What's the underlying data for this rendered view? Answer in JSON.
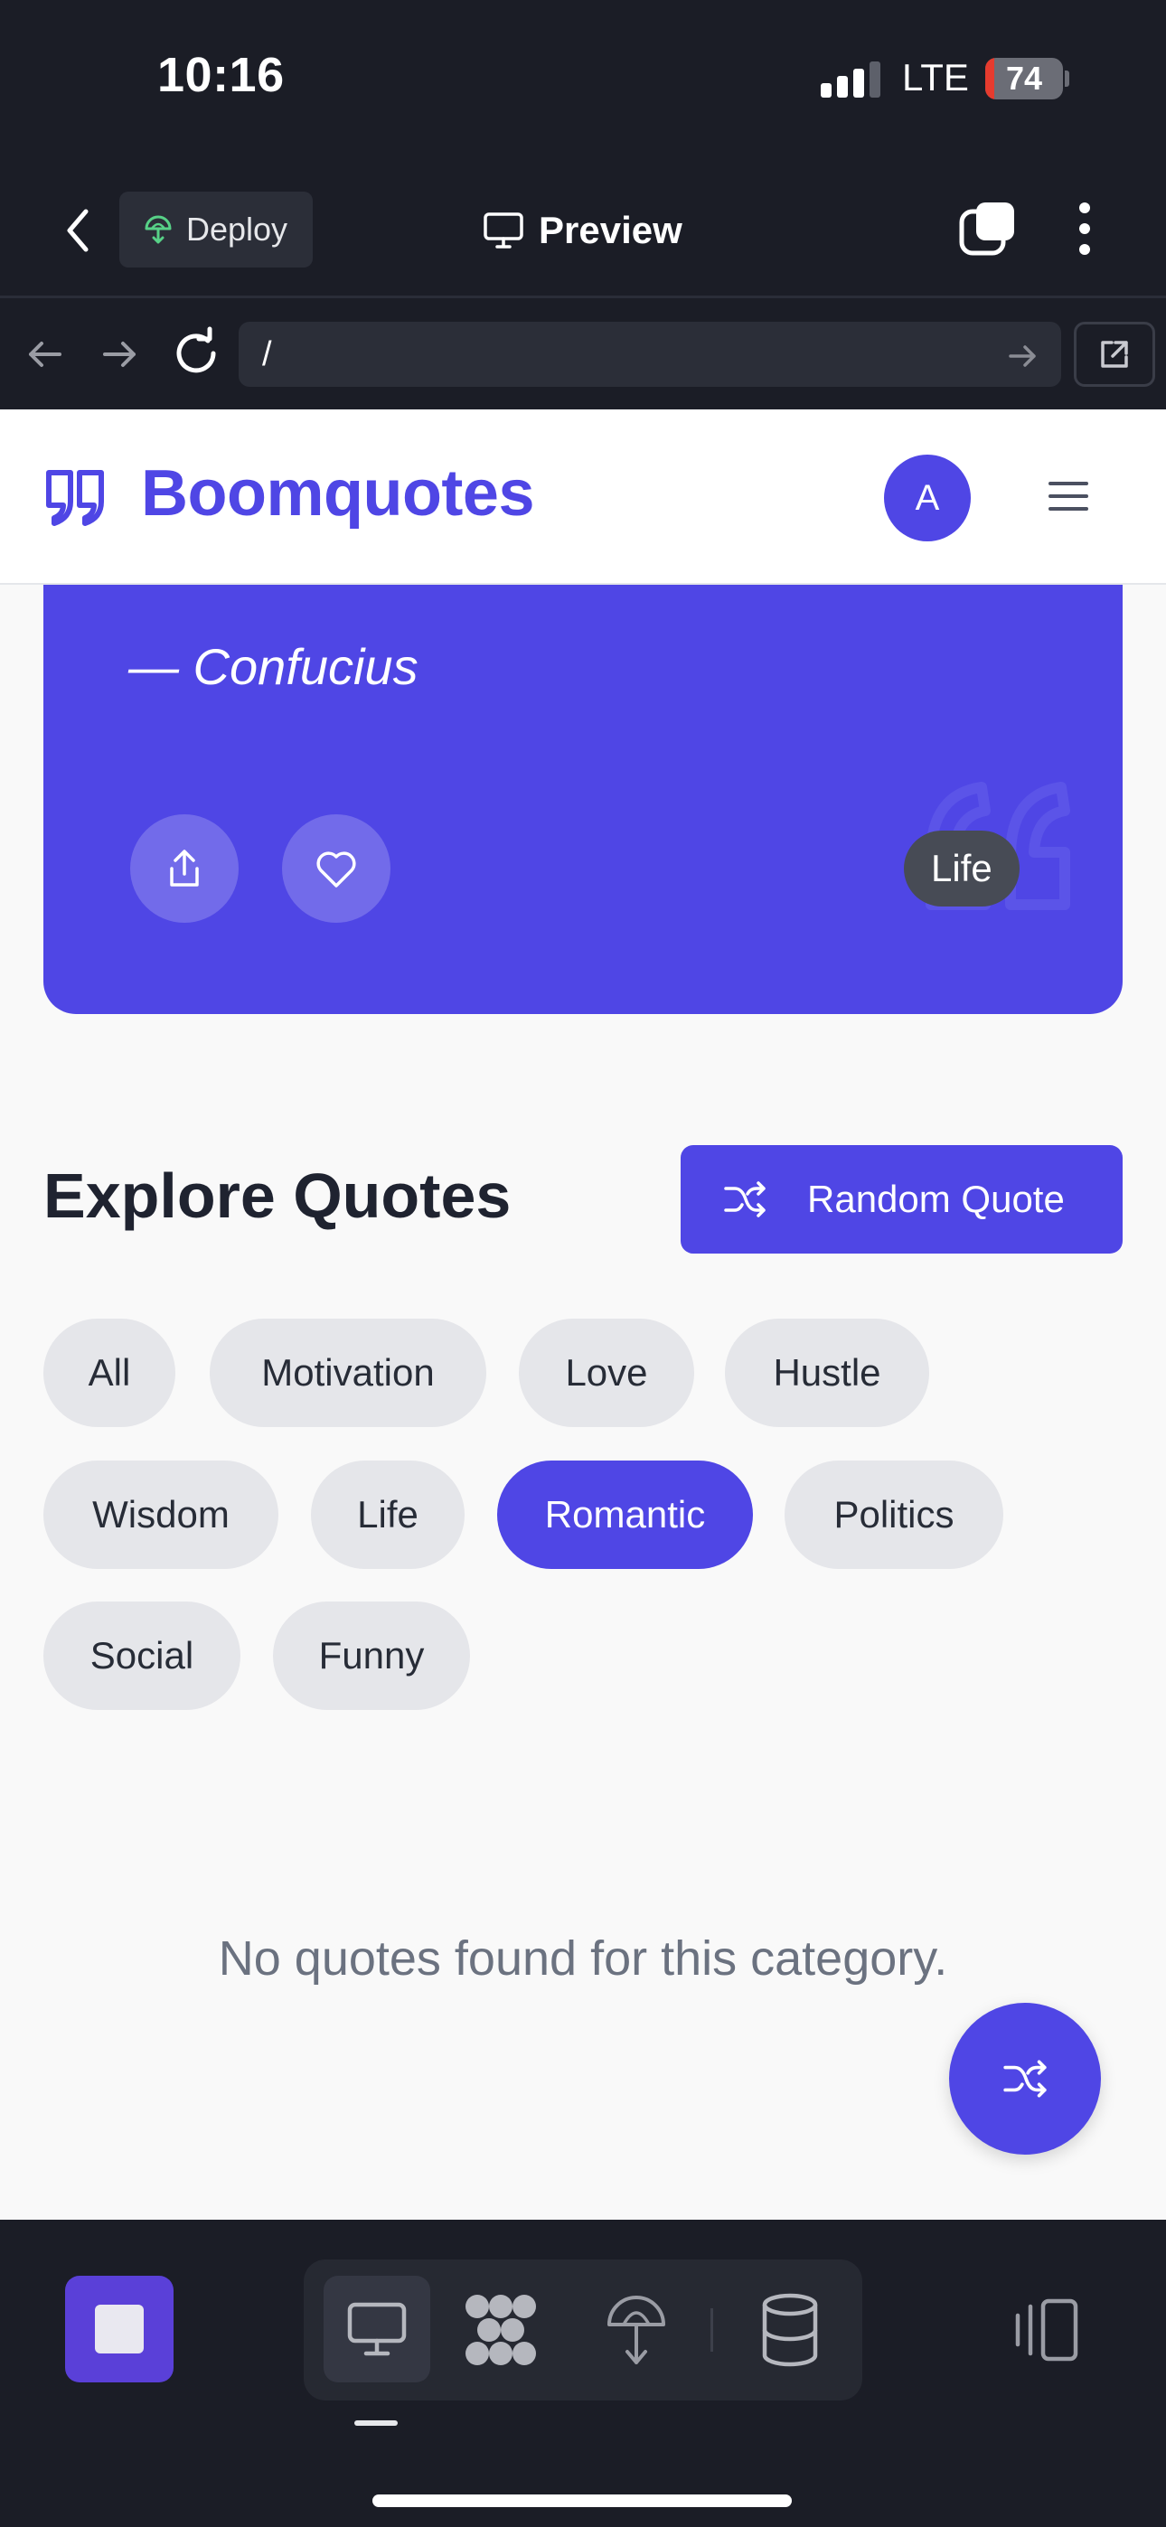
{
  "status_bar": {
    "time": "10:16",
    "network": "LTE",
    "battery_percent": 74,
    "battery_label": "74",
    "signal_bars_active": 3
  },
  "topbar": {
    "deploy_label": "Deploy",
    "preview_label": "Preview"
  },
  "url_bar": {
    "url": "/"
  },
  "site": {
    "title": "Boomquotes",
    "avatar_initial": "A",
    "brand_color": "#4f46e5"
  },
  "quote_card": {
    "author": "— Confucius",
    "category": "Life"
  },
  "explore": {
    "title": "Explore Quotes",
    "random_button_label": "Random Quote",
    "categories": [
      "All",
      "Motivation",
      "Love",
      "Hustle",
      "Wisdom",
      "Life",
      "Romantic",
      "Politics",
      "Social",
      "Funny"
    ],
    "active_category": "Romantic",
    "empty_message": "No quotes found for this category."
  },
  "icons": {
    "back": "chevron-left-icon",
    "deploy": "deploy-icon",
    "preview": "monitor-icon",
    "tabs": "tabs-icon",
    "more": "more-vertical-icon",
    "share": "share-icon",
    "favorite": "heart-icon",
    "shuffle": "shuffle-icon",
    "menu": "menu-icon",
    "database": "database-icon"
  }
}
